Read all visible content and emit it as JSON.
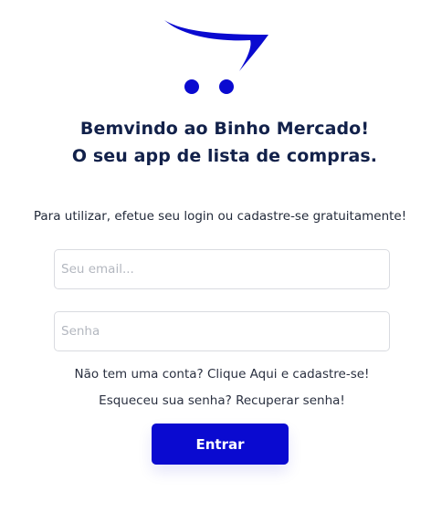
{
  "brand": {
    "logo_icon": "shopping-cart-swoosh-icon",
    "accent_color": "#0a0ad0"
  },
  "welcome": {
    "line1": "Bemvindo ao Binho Mercado!",
    "line2": "O seu app de lista de compras."
  },
  "instructions": "Para utilizar, efetue seu login ou cadastre-se gratuitamente!",
  "form": {
    "email_placeholder": "Seu email...",
    "email_value": "",
    "password_placeholder": "Senha",
    "password_value": ""
  },
  "links": {
    "signup": "Não tem uma conta? Clique Aqui e cadastre-se!",
    "recover": "Esqueceu sua senha? Recuperar senha!"
  },
  "submit_label": "Entrar"
}
